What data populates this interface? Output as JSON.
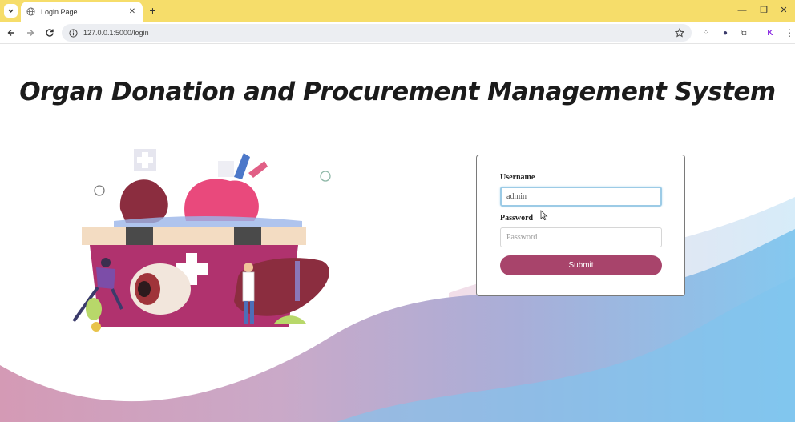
{
  "browser": {
    "tab_title": "Login Page",
    "tab_close": "✕",
    "new_tab": "+",
    "url": "127.0.0.1:5000/login",
    "window_controls": {
      "minimize": "—",
      "restore": "❐",
      "close": "✕"
    },
    "extensions": [
      {
        "icon": "grid-extension-icon",
        "glyph": "⁘"
      },
      {
        "icon": "profile-extension-icon",
        "glyph": "●"
      },
      {
        "icon": "puzzle-extensions-icon",
        "glyph": "⧉"
      },
      {
        "icon": "k-extension-icon",
        "glyph": "K"
      },
      {
        "icon": "more-menu-icon",
        "glyph": "⋮"
      }
    ],
    "accent": "#f6dd6a"
  },
  "page": {
    "headline": "Organ Donation and Procurement Management System",
    "login": {
      "username_label": "Username",
      "username_value": "admin",
      "password_label": "Password",
      "password_placeholder": "Password",
      "submit_label": "Submit"
    },
    "colors": {
      "submit": "#a8446b",
      "focus_ring": "#9ccbe6"
    }
  }
}
